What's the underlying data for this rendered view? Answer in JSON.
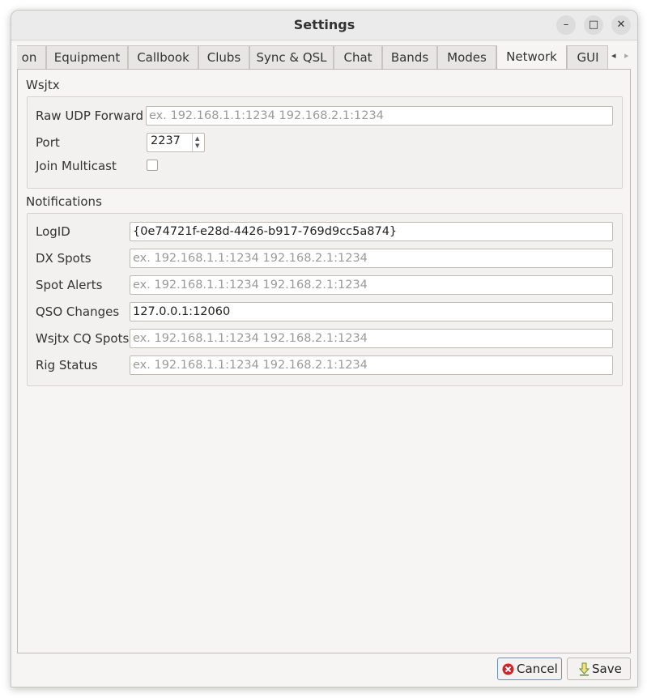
{
  "window": {
    "title": "Settings"
  },
  "titlebar_buttons": {
    "minimize": "–",
    "maximize": "□",
    "close": "✕"
  },
  "tabs": [
    {
      "label": "on"
    },
    {
      "label": "Equipment"
    },
    {
      "label": "Callbook"
    },
    {
      "label": "Clubs"
    },
    {
      "label": "Sync & QSL"
    },
    {
      "label": "Chat"
    },
    {
      "label": "Bands"
    },
    {
      "label": "Modes"
    },
    {
      "label": "Network",
      "active": true
    },
    {
      "label": "GUI"
    }
  ],
  "tab_scroll": {
    "left": "◂",
    "right": "▸"
  },
  "wsjtx": {
    "group_title": "Wsjtx",
    "raw_udp_forward": {
      "label": "Raw UDP Forward",
      "value": "",
      "placeholder": "ex. 192.168.1.1:1234 192.168.2.1:1234"
    },
    "port": {
      "label": "Port",
      "value": "2237"
    },
    "join_multicast": {
      "label": "Join Multicast",
      "checked": false
    }
  },
  "notifications": {
    "group_title": "Notifications",
    "logid": {
      "label": "LogID",
      "value": "{0e74721f-e28d-4426-b917-769d9cc5a874}"
    },
    "dx_spots": {
      "label": "DX Spots",
      "value": "",
      "placeholder": "ex. 192.168.1.1:1234 192.168.2.1:1234"
    },
    "spot_alerts": {
      "label": "Spot Alerts",
      "value": "",
      "placeholder": "ex. 192.168.1.1:1234 192.168.2.1:1234"
    },
    "qso_changes": {
      "label": "QSO Changes",
      "value": "127.0.0.1:12060"
    },
    "wsjtx_cq_spots": {
      "label": "Wsjtx CQ Spots",
      "value": "",
      "placeholder": "ex. 192.168.1.1:1234 192.168.2.1:1234"
    },
    "rig_status": {
      "label": "Rig Status",
      "value": "",
      "placeholder": "ex. 192.168.1.1:1234 192.168.2.1:1234"
    }
  },
  "buttons": {
    "cancel": "Cancel",
    "save": "Save"
  },
  "colors": {
    "cancel_icon": "#d0232a",
    "save_icon": "#6aa84f"
  }
}
